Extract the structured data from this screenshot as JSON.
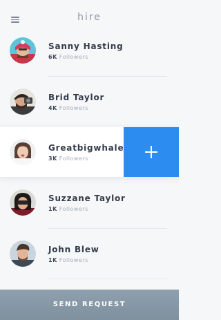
{
  "header": {
    "title": "hire",
    "menu_icon": "hamburger-menu-icon"
  },
  "users": [
    {
      "name": "Sanny Hasting",
      "count": "6K",
      "unit": "Followers"
    },
    {
      "name": "Brid Taylor",
      "count": "4K",
      "unit": "Followers"
    },
    {
      "name": "Greatbigwhale",
      "count": "3K",
      "unit": "Followers"
    },
    {
      "name": "Suzzane Taylor",
      "count": "1K",
      "unit": "Followers"
    },
    {
      "name": "John Blew",
      "count": "1K",
      "unit": "Followers"
    }
  ],
  "add_action": {
    "icon": "plus-icon",
    "color": "#2d8cf0"
  },
  "footer": {
    "send_label": "SEND REQUEST"
  }
}
